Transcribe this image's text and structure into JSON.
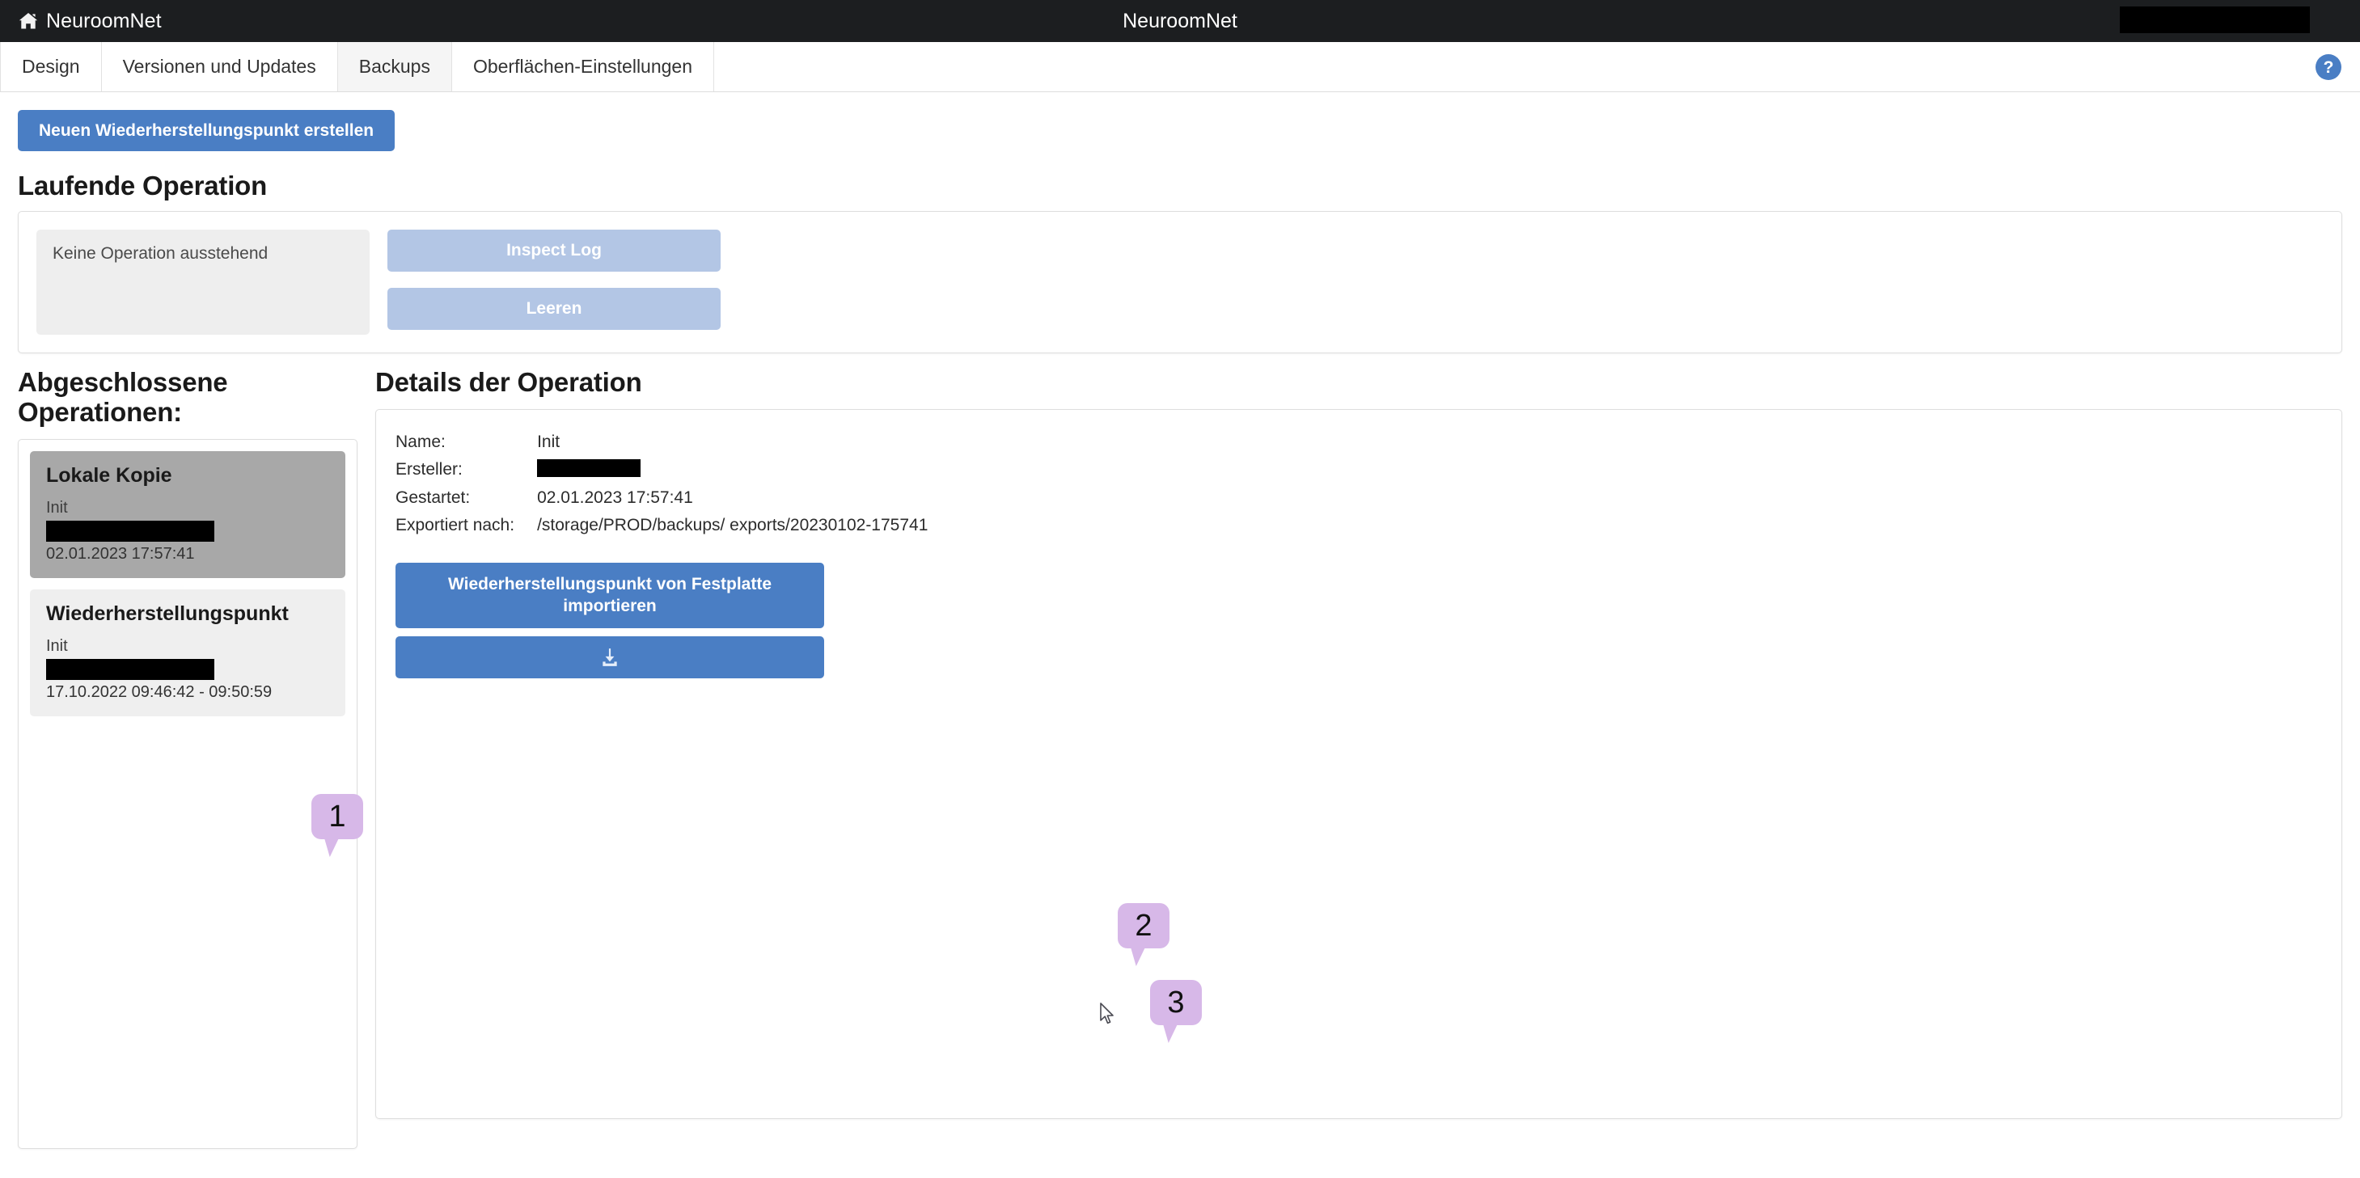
{
  "navbar": {
    "brand": "NeuroomNet",
    "center_title": "NeuroomNet",
    "home_icon": "home-icon",
    "redacted_right": ""
  },
  "tabs": [
    {
      "label": "Design",
      "active": false
    },
    {
      "label": "Versionen und Updates",
      "active": false
    },
    {
      "label": "Backups",
      "active": true
    },
    {
      "label": "Oberflächen-Einstellungen",
      "active": false
    }
  ],
  "help": {
    "icon": "help-circle-icon",
    "label": "?"
  },
  "toolbar": {
    "create_restore_point_label": "Neuen Wiederherstellungspunkt erstellen"
  },
  "running_operation": {
    "heading": "Laufende Operation",
    "status_text": "Keine Operation ausstehend",
    "inspect_log_label": "Inspect Log",
    "clear_label": "Leeren"
  },
  "completed_operations": {
    "heading": "Abgeschlossene Operationen:",
    "items": [
      {
        "title": "Lokale Kopie",
        "subtitle": "Init",
        "creator_redacted": "",
        "date": "02.01.2023 17:57:41",
        "selected": true
      },
      {
        "title": "Wiederherstellungspunkt",
        "subtitle": "Init",
        "creator_redacted": "",
        "date": "17.10.2022 09:46:42 - 09:50:59",
        "selected": false
      }
    ]
  },
  "details": {
    "heading": "Details der Operation",
    "fields": [
      {
        "key": "Name:",
        "value": "Init"
      },
      {
        "key": "Ersteller:",
        "value": ""
      },
      {
        "key": "Gestartet:",
        "value": "02.01.2023 17:57:41"
      },
      {
        "key": "Exportiert nach:",
        "value": "/storage/PROD/backups/               exports/20230102-175741"
      }
    ],
    "import_button_label": "Wiederherstellungspunkt von Festplatte importieren",
    "download_button_icon": "download-icon"
  },
  "annotations": [
    {
      "number": "1"
    },
    {
      "number": "2"
    },
    {
      "number": "3"
    }
  ],
  "colors": {
    "navbar_bg": "#1c1e20",
    "primary_blue": "#4a7ec4",
    "disabled_blue": "#b3c6e5",
    "selected_card": "#a8a8a8",
    "card_bg": "#efefef",
    "callout_purple": "#d7b8e8",
    "status_box_bg": "#eeeeee"
  }
}
